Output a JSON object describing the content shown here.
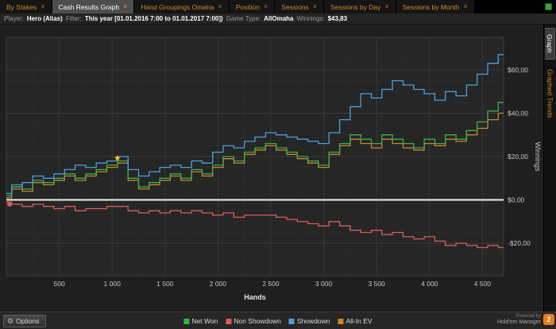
{
  "tabs": {
    "close_glyph": "×",
    "items": [
      {
        "label": "By Stakes",
        "active": false
      },
      {
        "label": "Cash Results Graph",
        "active": true
      },
      {
        "label": "Hand Groupings Omaha",
        "active": false
      },
      {
        "label": "Position",
        "active": false
      },
      {
        "label": "Sessions",
        "active": false
      },
      {
        "label": "Sessions by Day",
        "active": false
      },
      {
        "label": "Sessions by Month",
        "active": false
      }
    ]
  },
  "info_bar": {
    "player_label": "Player:",
    "player_value": "Hero (Alias)",
    "filter_label": "Filter:",
    "filter_value": "This year [01.01.2016 7:00 to 01.01.2017 7:00])",
    "game_type_label": "Game Type:",
    "game_type_value": "AllOmaha",
    "winnings_label": "Winnings:",
    "winnings_value": "$43,83"
  },
  "side_tabs": {
    "graph": "Graph",
    "graphed_trends": "Graphed Trends"
  },
  "bottom_bar": {
    "options_label": "Options",
    "powered_by": "Powered by",
    "brand": "Hold'em Manager",
    "brand_badge": "2"
  },
  "chart_data": {
    "type": "line",
    "title": "",
    "xlabel": "Hands",
    "ylabel": "Winnings",
    "xlim": [
      0,
      4700
    ],
    "ylim": [
      -35,
      75
    ],
    "x_ticks": [
      500,
      1000,
      1500,
      2000,
      2500,
      3000,
      3500,
      4000,
      4500
    ],
    "x_tick_labels": [
      "500",
      "1 000",
      "1 500",
      "2 000",
      "2 500",
      "3 000",
      "3 500",
      "4 000",
      "4 500"
    ],
    "y_ticks": [
      60,
      40,
      20,
      0,
      -20
    ],
    "y_tick_labels": [
      "$60,00",
      "$40,00",
      "$20,00",
      "$0,00",
      "-$20,00"
    ],
    "minor_x_step": 250,
    "minor_y_step": 5,
    "zero_line_color": "#f2f2f2",
    "grid": true,
    "legend_position": "bottom",
    "x": [
      0,
      100,
      200,
      300,
      400,
      500,
      600,
      700,
      800,
      900,
      1000,
      1100,
      1200,
      1300,
      1400,
      1500,
      1600,
      1700,
      1800,
      1900,
      2000,
      2100,
      2200,
      2300,
      2400,
      2500,
      2600,
      2700,
      2800,
      2900,
      3000,
      3100,
      3200,
      3300,
      3400,
      3500,
      3600,
      3700,
      3800,
      3900,
      4000,
      4100,
      4200,
      4300,
      4400,
      4500,
      4600,
      4700
    ],
    "series": [
      {
        "name": "Net Won",
        "color": "#3cb04a",
        "values": [
          2,
          7,
          5,
          9,
          8,
          10,
          12,
          10,
          12,
          14,
          16,
          18,
          10,
          6,
          8,
          10,
          12,
          10,
          14,
          12,
          16,
          20,
          18,
          22,
          24,
          26,
          24,
          22,
          20,
          18,
          16,
          22,
          26,
          30,
          28,
          26,
          30,
          28,
          26,
          24,
          28,
          26,
          30,
          28,
          32,
          36,
          41,
          45
        ]
      },
      {
        "name": "Non Showdown",
        "color": "#d95c5c",
        "values": [
          -1,
          -2,
          -3,
          -2,
          -3,
          -4,
          -3,
          -5,
          -4,
          -4,
          -3,
          -3,
          -5,
          -6,
          -5,
          -6,
          -5,
          -6,
          -5,
          -6,
          -7,
          -6,
          -8,
          -7,
          -7,
          -7,
          -8,
          -9,
          -10,
          -11,
          -12,
          -10,
          -12,
          -14,
          -15,
          -14,
          -16,
          -15,
          -17,
          -18,
          -17,
          -19,
          -21,
          -20,
          -21,
          -22,
          -21,
          -22
        ]
      },
      {
        "name": "Showdown",
        "color": "#4aa0e0",
        "values": [
          3,
          6,
          8,
          11,
          10,
          12,
          14,
          16,
          15,
          17,
          18,
          20,
          14,
          11,
          13,
          15,
          16,
          15,
          18,
          17,
          22,
          25,
          24,
          27,
          29,
          31,
          30,
          29,
          28,
          27,
          26,
          31,
          37,
          43,
          49,
          47,
          51,
          55,
          53,
          51,
          49,
          46,
          50,
          48,
          53,
          58,
          63,
          67
        ]
      },
      {
        "name": "All-In EV",
        "color": "#c8862c",
        "values": [
          1,
          5,
          4,
          8,
          7,
          9,
          11,
          9,
          11,
          13,
          15,
          17,
          9,
          5,
          7,
          9,
          11,
          9,
          13,
          11,
          15,
          19,
          17,
          21,
          23,
          25,
          23,
          21,
          19,
          17,
          15,
          21,
          25,
          28,
          26,
          24,
          28,
          26,
          24,
          23,
          26,
          25,
          28,
          27,
          30,
          33,
          37,
          40
        ]
      }
    ],
    "markers": [
      {
        "shape": "star",
        "x": 1050,
        "y": 19,
        "color": "#ffd94a"
      },
      {
        "shape": "circle",
        "x": 30,
        "y": -2,
        "color": "#d95c5c"
      }
    ]
  }
}
